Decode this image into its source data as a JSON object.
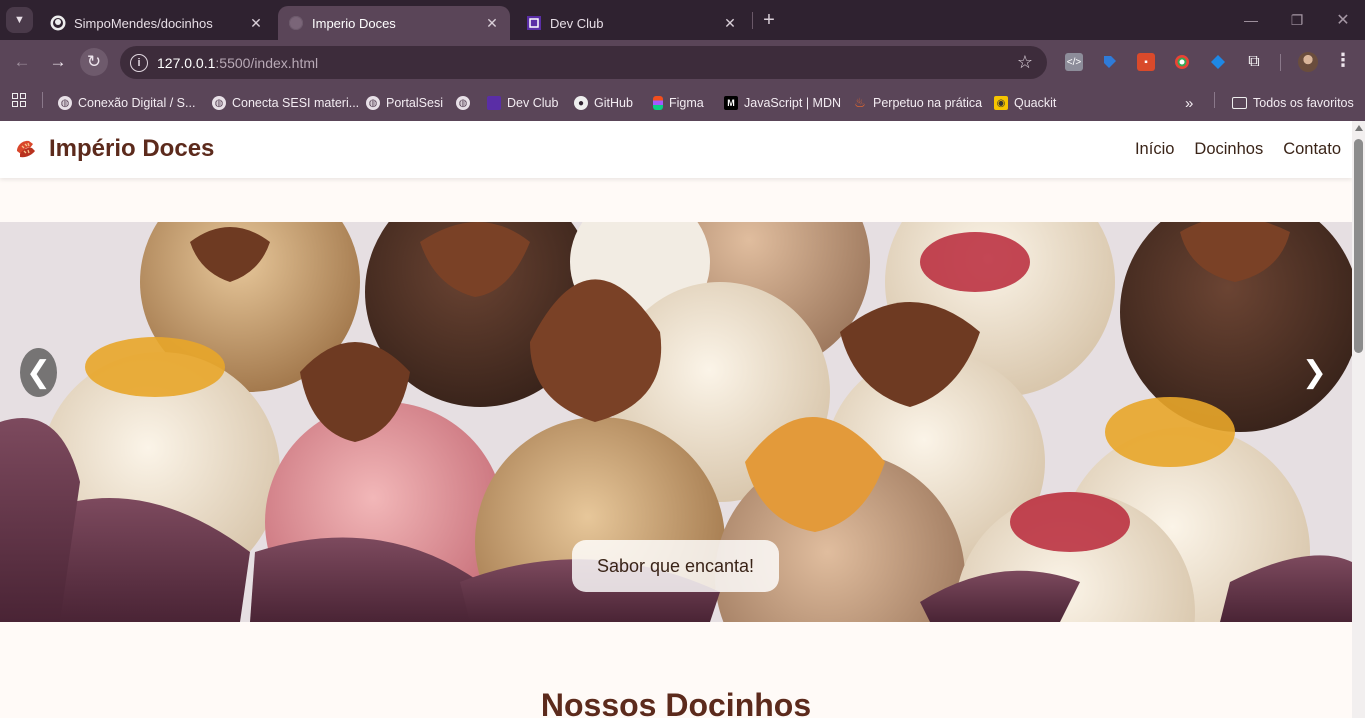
{
  "browser": {
    "tabs": [
      {
        "title": "SimpoMendes/docinhos",
        "icon": "github-icon",
        "active": false
      },
      {
        "title": "Imperio Doces",
        "icon": "globe-icon",
        "active": true
      },
      {
        "title": "Dev Club",
        "icon": "devclub-icon",
        "active": false
      }
    ],
    "url_host": "127.0.0.1",
    "url_rest": ":5500/index.html",
    "bookmarks": [
      {
        "label": "Conexão Digital / S...",
        "icon": "globe-icon"
      },
      {
        "label": "Conecta SESI materi...",
        "icon": "globe-icon"
      },
      {
        "label": "PortalSesi",
        "icon": "globe-icon"
      },
      {
        "label": "",
        "icon": "globe-icon"
      },
      {
        "label": "Dev Club",
        "icon": "devclub-icon"
      },
      {
        "label": "GitHub",
        "icon": "github-icon"
      },
      {
        "label": "Figma",
        "icon": "figma-icon"
      },
      {
        "label": "JavaScript | MDN",
        "icon": "mdn-icon"
      },
      {
        "label": "Perpetuo na prática",
        "icon": "flame-icon"
      },
      {
        "label": "Quackit",
        "icon": "quackit-icon"
      }
    ],
    "more_bookmarks": "»",
    "all_favorites": "Todos os favoritos"
  },
  "site": {
    "brand": "Império Doces",
    "nav": [
      "Início",
      "Docinhos",
      "Contato"
    ],
    "carousel": {
      "caption": "Sabor que encanta!",
      "prev": "❮",
      "next": "❯"
    },
    "section_title": "Nossos Docinhos"
  },
  "colors": {
    "brand": "#5c2a1c",
    "chrome_tab": "#5a4558",
    "chrome_strip": "#2f2230"
  }
}
